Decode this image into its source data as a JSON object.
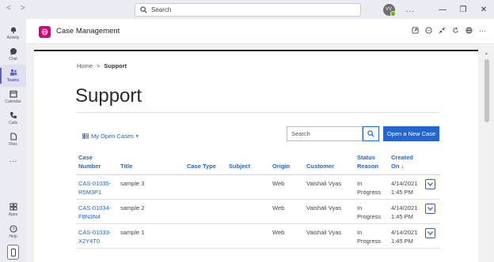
{
  "titlebar": {
    "search_placeholder": "Search",
    "avatar_initials": "VV",
    "more_label": "...",
    "minimize": "—",
    "maximize": "❐",
    "close": "✕"
  },
  "rail": {
    "items": [
      {
        "label": "Activity",
        "icon": "bell-icon"
      },
      {
        "label": "Chat",
        "icon": "chat-icon"
      },
      {
        "label": "Teams",
        "icon": "teams-icon"
      },
      {
        "label": "Calendar",
        "icon": "calendar-icon"
      },
      {
        "label": "Calls",
        "icon": "phone-icon"
      },
      {
        "label": "Files",
        "icon": "file-icon"
      },
      {
        "label": "···",
        "icon": "more-icon"
      },
      {
        "label": "Apps",
        "icon": "apps-icon"
      },
      {
        "label": "Help",
        "icon": "help-icon"
      }
    ]
  },
  "app": {
    "title": "Case Management",
    "brand_color": "#d4007a"
  },
  "breadcrumb": {
    "home": "Home",
    "separator": ">",
    "current": "Support"
  },
  "page": {
    "title": "Support"
  },
  "toolbar": {
    "view_label": "My Open Cases",
    "search_placeholder": "Search",
    "new_case_label": "Open a New Case",
    "accent": "#2366d1"
  },
  "table": {
    "columns": {
      "case_number_1": "Case",
      "case_number_2": "Number",
      "title": "Title",
      "case_type": "Case Type",
      "subject": "Subject",
      "origin": "Origin",
      "customer": "Customer",
      "status_reason_1": "Status",
      "status_reason_2": "Reason",
      "created_on_1": "Created",
      "created_on_2": "On",
      "sort_indicator": "↓"
    },
    "rows": [
      {
        "case_number_1": "CAS-01035-",
        "case_number_2": "R5M3P1",
        "title": "sample 3",
        "case_type": "",
        "subject": "",
        "origin": "Web",
        "customer": "Vaishali Vyas",
        "status_1": "In",
        "status_2": "Progress",
        "created_1": "4/14/2021",
        "created_2": "1:45 PM"
      },
      {
        "case_number_1": "CAS-01034-",
        "case_number_2": "F8N3N4",
        "title": "sample 2",
        "case_type": "",
        "subject": "",
        "origin": "Web",
        "customer": "Vaishali Vyas",
        "status_1": "In",
        "status_2": "Progress",
        "created_1": "4/14/2021",
        "created_2": "1:45 PM"
      },
      {
        "case_number_1": "CAS-01033-",
        "case_number_2": "X2Y4T0",
        "title": "sample 1",
        "case_type": "",
        "subject": "",
        "origin": "Web",
        "customer": "Vaishali Vyas",
        "status_1": "In",
        "status_2": "Progress",
        "created_1": "4/14/2021",
        "created_2": "1:45 PM"
      }
    ]
  }
}
